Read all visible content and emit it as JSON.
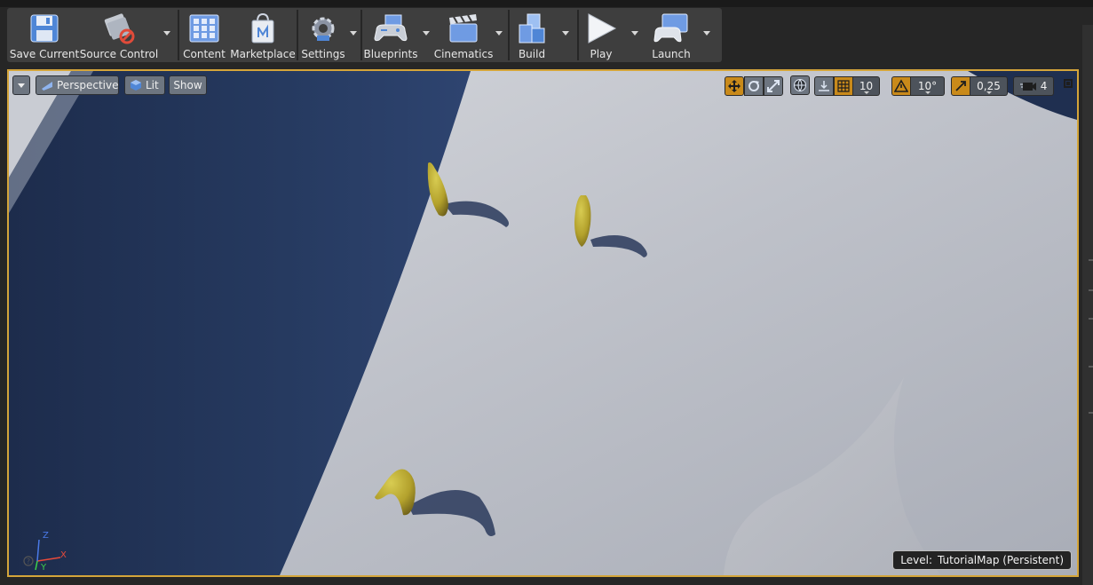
{
  "toolbar": {
    "save_current": "Save Current",
    "source_control": "Source Control",
    "content": "Content",
    "marketplace": "Marketplace",
    "settings": "Settings",
    "blueprints": "Blueprints",
    "cinematics": "Cinematics",
    "build": "Build",
    "play": "Play",
    "launch": "Launch"
  },
  "viewport": {
    "perspective": "Perspective",
    "lit": "Lit",
    "show": "Show",
    "grid_snap": "10",
    "rotation_snap": "10°",
    "scale_snap": "0,25",
    "camera_speed": "4",
    "level_prefix": "Level:",
    "level_name": "TutorialMap (Persistent)",
    "axis_x": "X",
    "axis_z": "Z",
    "axis_y": "Y"
  },
  "colors": {
    "accent": "#d4a53a",
    "snap_active": "#c98a1a",
    "floor": "#b4b8c2",
    "shadow": "#24365a"
  }
}
